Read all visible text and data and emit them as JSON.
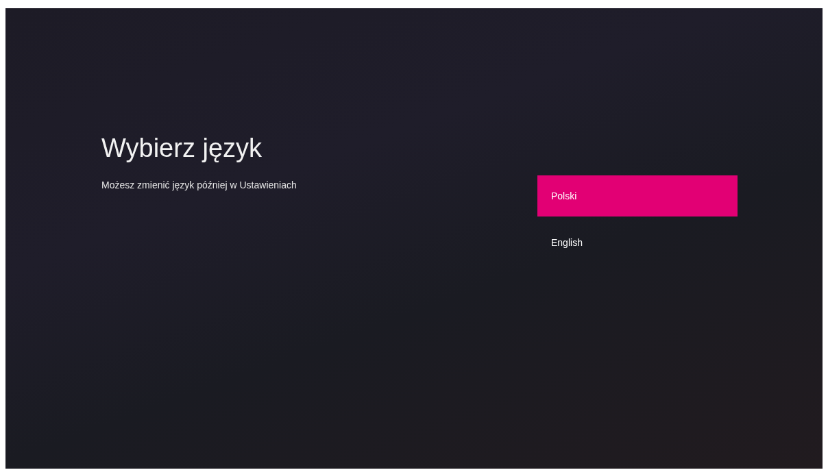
{
  "title": "Wybierz język",
  "subtitle": "Możesz zmienić język później w Ustawieniach",
  "languages": [
    {
      "label": "Polski",
      "selected": true
    },
    {
      "label": "English",
      "selected": false
    }
  ]
}
